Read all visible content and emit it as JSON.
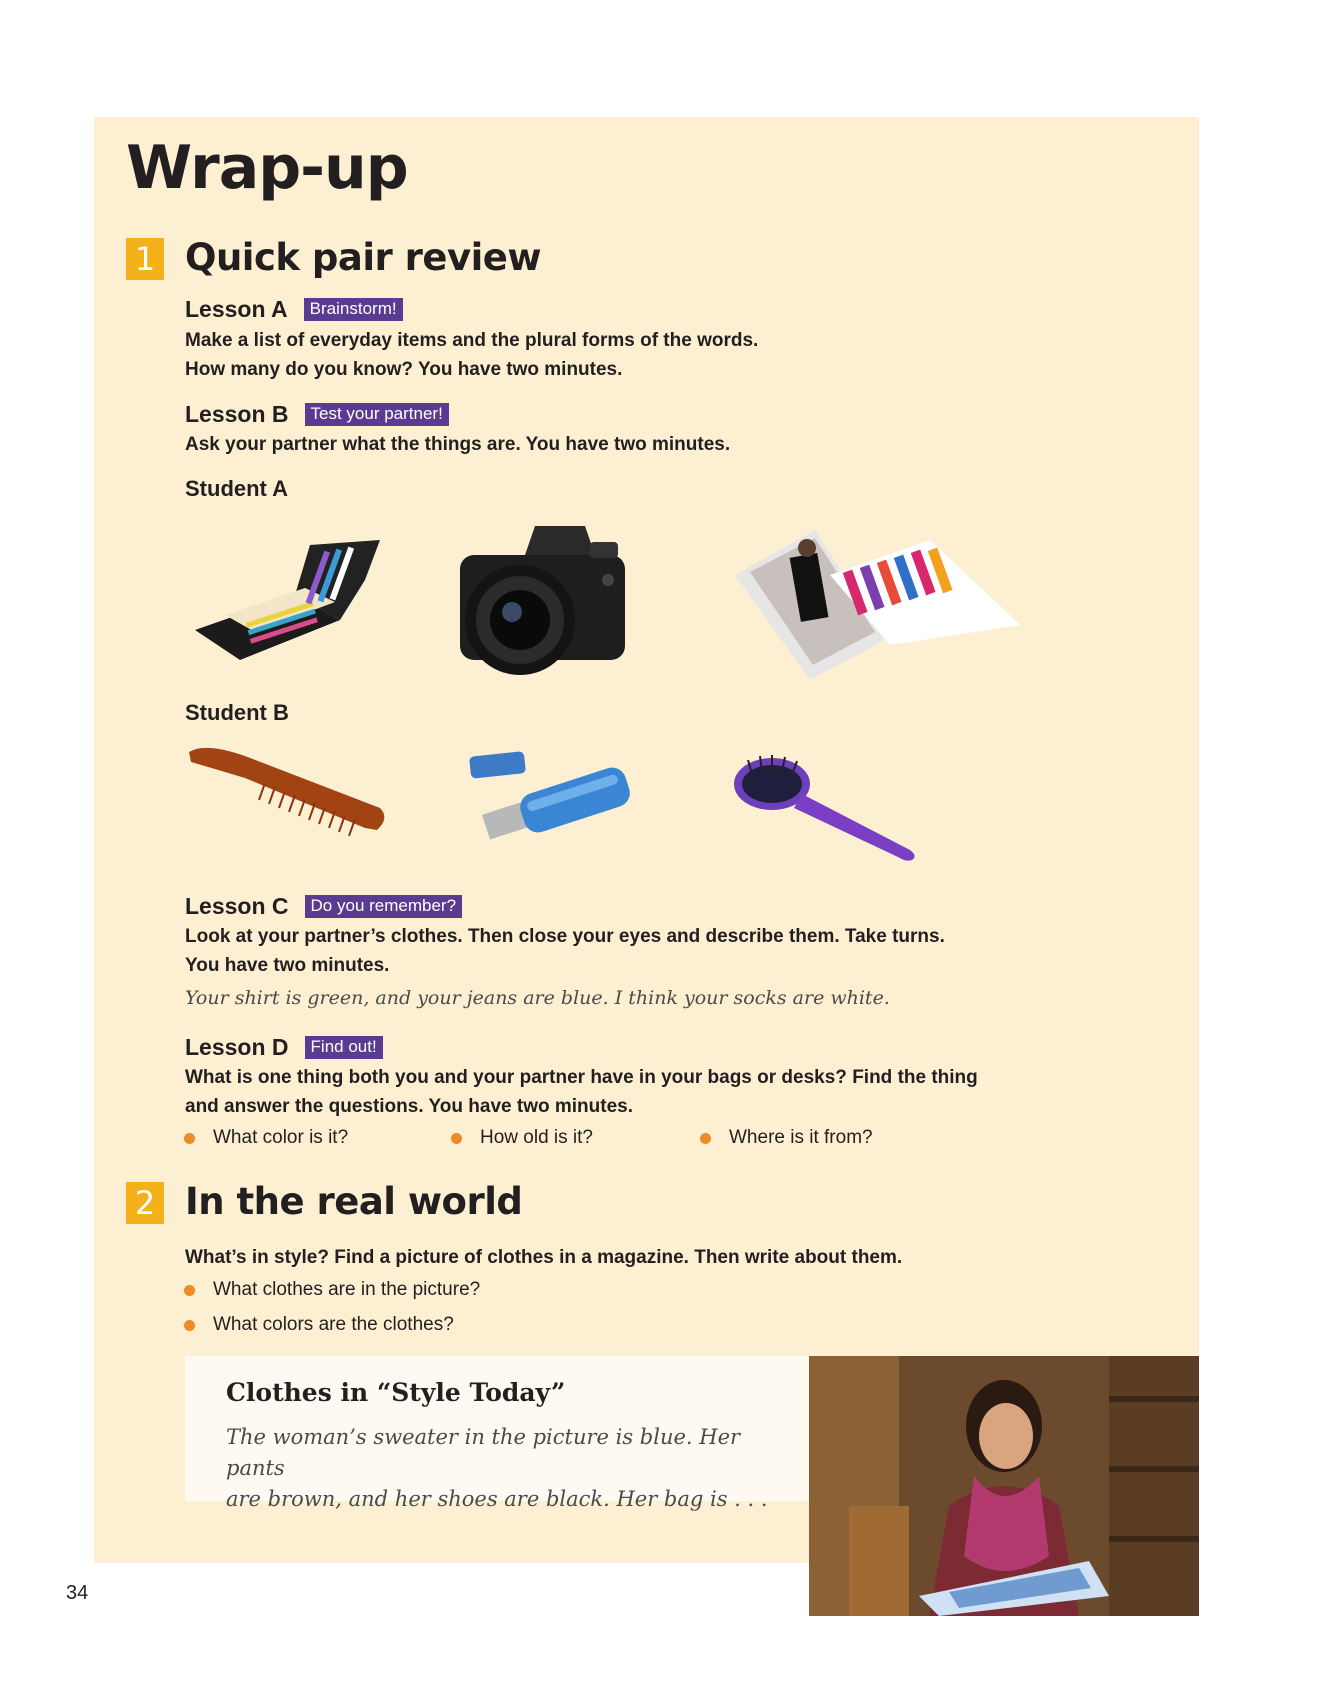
{
  "title": "Wrap-up",
  "section1": {
    "number": "1",
    "title": "Quick pair review",
    "lessonA": {
      "name": "Lesson A",
      "tag": "Brainstorm!",
      "line1": "Make a list of everyday items and the plural forms of the words.",
      "line2": "How many do you know? You have two minutes."
    },
    "lessonB": {
      "name": "Lesson B",
      "tag": "Test your partner!",
      "line1": "Ask your partner what the things are. You have two minutes.",
      "studentA": "Student A",
      "studentB": "Student B"
    },
    "lessonC": {
      "name": "Lesson C",
      "tag": "Do you remember?",
      "line1": "Look at your partner’s clothes. Then close your eyes and describe them. Take turns.",
      "line2": "You have two minutes.",
      "example": "Your shirt is green, and your jeans are blue. I think your socks are white."
    },
    "lessonD": {
      "name": "Lesson D",
      "tag": "Find out!",
      "line1": "What is one thing both you and your partner have in your bags or desks? Find the thing",
      "line2": "and answer the questions. You have two minutes.",
      "questions": [
        "What color is it?",
        "How old is it?",
        "Where is it from?"
      ]
    }
  },
  "section2": {
    "number": "2",
    "title": "In the real world",
    "intro": "What’s in style? Find a picture of clothes in a magazine. Then write about them.",
    "bullets": [
      "What clothes are in the picture?",
      "What colors are the clothes?"
    ],
    "note": {
      "title": "Clothes in “Style Today”",
      "body_line1": "The woman’s sweater in the picture is blue. Her pants",
      "body_line2": "are brown, and her shoes are black. Her bag is . . ."
    }
  },
  "page_number": "34",
  "colors": {
    "panel": "#fdf0d2",
    "accent_yellow": "#f5b119",
    "tag_purple": "#5b3b91",
    "bullet_orange": "#f08a24"
  }
}
